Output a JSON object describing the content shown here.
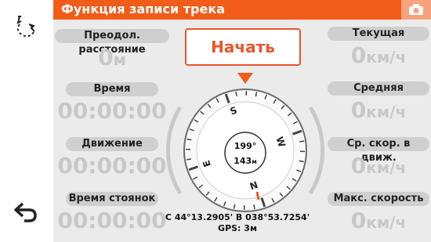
{
  "header": {
    "title": "Функция записи трека"
  },
  "sidebar": {
    "top_icon": "track-points-icon",
    "back_icon": "back-arrow-icon"
  },
  "camera_icon": "camera-icon",
  "start_button": {
    "label": "Начать"
  },
  "left_stats": [
    {
      "label": "Преодол. расстояние",
      "value": "0",
      "unit": "м"
    },
    {
      "label": "Время",
      "value": "00:00:00",
      "unit": ""
    },
    {
      "label": "Движение",
      "value": "00:00:00",
      "unit": ""
    },
    {
      "label": "Время стоянок",
      "value": "00:00:00",
      "unit": ""
    }
  ],
  "right_stats": [
    {
      "label": "Текущая",
      "value": "0",
      "unit": "км/ч"
    },
    {
      "label": "Средняя",
      "value": "0",
      "unit": "км/ч"
    },
    {
      "label": "Ср. скор. в движ.",
      "value": "0",
      "unit": "км/ч"
    },
    {
      "label": "Макс. скорость",
      "value": "0",
      "unit": "км/ч"
    }
  ],
  "compass": {
    "heading": "199°",
    "distance": "143",
    "distance_unit": "м",
    "cardinals": {
      "s": "S",
      "w": "W",
      "n": "N",
      "e": "E"
    }
  },
  "location": {
    "coords": "С 44°13.2905' В 038°53.7254'",
    "gps": "GPS: 3м"
  },
  "colors": {
    "accent": "#f25c19",
    "value_gray": "#c8c8c8",
    "pill": "#cfcfcf"
  }
}
